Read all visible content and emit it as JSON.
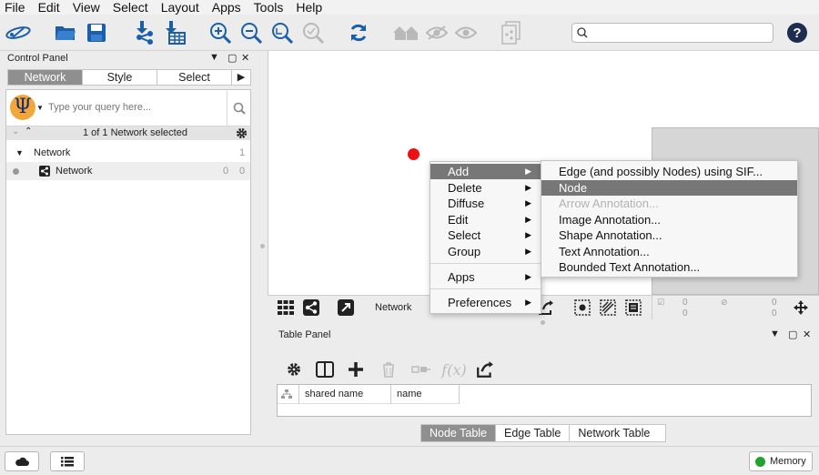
{
  "menubar": [
    "File",
    "Edit",
    "View",
    "Select",
    "Layout",
    "Apps",
    "Tools",
    "Help"
  ],
  "control_panel": {
    "title": "Control Panel",
    "tabs": [
      "Network",
      "Style",
      "Select"
    ],
    "active_tab": "Network",
    "query_placeholder": "Type your query here...",
    "selection_status": "1 of 1 Network selected",
    "tree": {
      "collection": {
        "label": "Network",
        "count": "1"
      },
      "network": {
        "label": "Network",
        "nodes": "0",
        "edges": "0"
      }
    }
  },
  "network_view": {
    "node_color": "#ee1111",
    "bottom_label": "Network",
    "counts": {
      "selected_nodes": "0",
      "total_nodes": "0",
      "hidden_nodes": "0",
      "total_edges": "0"
    }
  },
  "context_menu": {
    "items": [
      {
        "label": "Add",
        "submenu": true,
        "highlighted": true
      },
      {
        "label": "Delete",
        "submenu": true
      },
      {
        "label": "Diffuse",
        "submenu": true
      },
      {
        "label": "Edit",
        "submenu": true
      },
      {
        "label": "Select",
        "submenu": true
      },
      {
        "label": "Group",
        "submenu": true
      },
      {
        "label": "Apps",
        "submenu": true
      },
      {
        "label": "Preferences",
        "submenu": true
      }
    ],
    "add_submenu": [
      {
        "label": "Edge (and possibly Nodes) using SIF..."
      },
      {
        "label": "Node",
        "highlighted": true
      },
      {
        "label": "Arrow Annotation...",
        "disabled": true
      },
      {
        "label": "Image Annotation..."
      },
      {
        "label": "Shape Annotation..."
      },
      {
        "label": "Text Annotation..."
      },
      {
        "label": "Bounded Text Annotation..."
      }
    ]
  },
  "table_panel": {
    "title": "Table Panel",
    "columns": [
      "shared name",
      "name"
    ],
    "tabs": [
      "Node Table",
      "Edge Table",
      "Network Table"
    ],
    "active_tab": "Node Table"
  },
  "status_bar": {
    "memory_label": "Memory",
    "memory_color": "#21a32f"
  },
  "colors": {
    "accent_blue": "#1b5fa8",
    "highlight_gray": "#777777"
  }
}
